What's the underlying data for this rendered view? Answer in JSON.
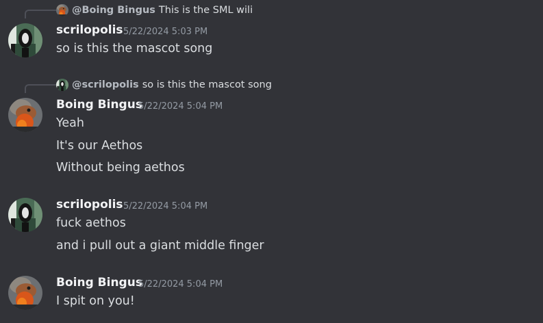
{
  "messages": [
    {
      "reply": {
        "author": "@Boing Bingus",
        "text": "This is the SML wili",
        "avatar_icon": "bird-avatar-icon"
      },
      "author": "scrilopolis",
      "timestamp": "5/22/2024 5:03 PM",
      "avatar_icon": "dark-figure-avatar-icon",
      "lines": [
        "so is this the mascot song"
      ]
    },
    {
      "reply": {
        "author": "@scrilopolis",
        "text": "so is this the mascot song",
        "avatar_icon": "dark-figure-avatar-icon"
      },
      "author": "Boing Bingus",
      "timestamp": "5/22/2024 5:04 PM",
      "avatar_icon": "bird-avatar-icon",
      "lines": [
        "Yeah",
        "It's our Aethos",
        "Without being aethos"
      ]
    },
    {
      "author": "scrilopolis",
      "timestamp": "5/22/2024 5:04 PM",
      "avatar_icon": "dark-figure-avatar-icon",
      "lines": [
        "fuck aethos",
        "and i pull out a giant middle finger"
      ]
    },
    {
      "author": "Boing Bingus",
      "timestamp": "5/22/2024 5:04 PM",
      "avatar_icon": "bird-avatar-icon",
      "lines": [
        "I spit on you!"
      ]
    }
  ],
  "colors": {
    "background": "#323338",
    "author": "#f2f3f5",
    "message_text": "#dbdee1",
    "timestamp": "#949ba4",
    "reply_author": "#b5bac1"
  }
}
